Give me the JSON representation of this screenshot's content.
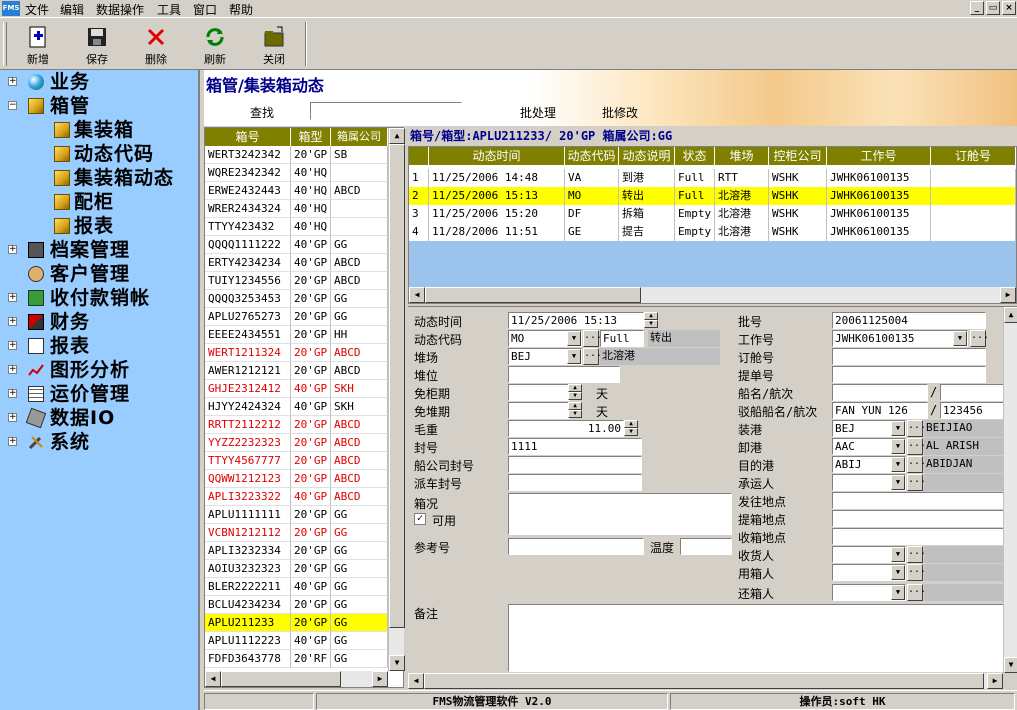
{
  "app": {
    "logo": "FMS"
  },
  "menu": [
    "文件",
    "编辑",
    "数据操作",
    "工具",
    "窗口",
    "帮助"
  ],
  "window_buttons": [
    "_",
    "▭",
    "×"
  ],
  "toolbar": {
    "new_label": "新增",
    "save_label": "保存",
    "delete_label": "删除",
    "refresh_label": "刷新",
    "close_label": "关闭"
  },
  "tree": [
    {
      "label": "业务",
      "icon": "globe-icon",
      "expanded": false
    },
    {
      "label": "箱管",
      "icon": "cube-icon",
      "expanded": true
    },
    {
      "label": "集装箱",
      "icon": "cube-icon",
      "child": true
    },
    {
      "label": "动态代码",
      "icon": "cube-icon",
      "child": true
    },
    {
      "label": "集装箱动态",
      "icon": "cube-icon",
      "child": true
    },
    {
      "label": "配柜",
      "icon": "cube-icon",
      "child": true
    },
    {
      "label": "报表",
      "icon": "cube-icon",
      "child": true
    },
    {
      "label": "档案管理",
      "icon": "cabinet-icon",
      "expanded": false
    },
    {
      "label": "客户管理",
      "icon": "customers-icon",
      "expanded": false
    },
    {
      "label": "收付款销帐",
      "icon": "money-icon",
      "expanded": false
    },
    {
      "label": "财务",
      "icon": "book-icon",
      "expanded": false
    },
    {
      "label": "报表",
      "icon": "report-icon",
      "expanded": false
    },
    {
      "label": "图形分析",
      "icon": "chart-icon",
      "expanded": false
    },
    {
      "label": "运价管理",
      "icon": "ledger-icon",
      "expanded": false
    },
    {
      "label": "数据IO",
      "icon": "data-io-icon",
      "expanded": false
    },
    {
      "label": "系统",
      "icon": "tools-icon",
      "expanded": false
    }
  ],
  "header": {
    "title": "箱管/集装箱动态",
    "search_label": "查找",
    "search_value": "",
    "batch_process": "批处理",
    "batch_edit": "批修改"
  },
  "container_list": {
    "columns": [
      "箱号",
      "箱型",
      "箱属公司"
    ],
    "rows": [
      {
        "no": "WERT3242342",
        "type": "20'GP",
        "owner": "SB",
        "color": "black"
      },
      {
        "no": "WQRE2342342",
        "type": "40'HQ",
        "owner": "",
        "color": "black"
      },
      {
        "no": "ERWE2432443",
        "type": "40'HQ",
        "owner": "ABCD",
        "color": "black"
      },
      {
        "no": "WRER2434324",
        "type": "40'HQ",
        "owner": "",
        "color": "black"
      },
      {
        "no": "TTYY423432",
        "type": "40'HQ",
        "owner": "",
        "color": "black"
      },
      {
        "no": "QQQQ1111222",
        "type": "40'GP",
        "owner": "GG",
        "color": "black"
      },
      {
        "no": "ERTY4234234",
        "type": "40'GP",
        "owner": "ABCD",
        "color": "black"
      },
      {
        "no": "TUIY1234556",
        "type": "20'GP",
        "owner": "ABCD",
        "color": "black"
      },
      {
        "no": "QQQQ3253453",
        "type": "20'GP",
        "owner": "GG",
        "color": "black"
      },
      {
        "no": "APLU2765273",
        "type": "20'GP",
        "owner": "GG",
        "color": "black"
      },
      {
        "no": "EEEE2434551",
        "type": "20'GP",
        "owner": "HH",
        "color": "black"
      },
      {
        "no": "WERT1211324",
        "type": "20'GP",
        "owner": "ABCD",
        "color": "red"
      },
      {
        "no": "AWER1212121",
        "type": "20'GP",
        "owner": "ABCD",
        "color": "black"
      },
      {
        "no": "GHJE2312412",
        "type": "40'GP",
        "owner": "SKH",
        "color": "red"
      },
      {
        "no": "HJYY2424324",
        "type": "40'GP",
        "owner": "SKH",
        "color": "black"
      },
      {
        "no": "RRTT2112212",
        "type": "20'GP",
        "owner": "ABCD",
        "color": "red"
      },
      {
        "no": "YYZZ2232323",
        "type": "20'GP",
        "owner": "ABCD",
        "color": "red"
      },
      {
        "no": "TTYY4567777",
        "type": "20'GP",
        "owner": "ABCD",
        "color": "red"
      },
      {
        "no": "QQWW1212123",
        "type": "20'GP",
        "owner": "ABCD",
        "color": "red"
      },
      {
        "no": "APLI3223322",
        "type": "40'GP",
        "owner": "ABCD",
        "color": "red"
      },
      {
        "no": "APLU1111111",
        "type": "20'GP",
        "owner": "GG",
        "color": "black"
      },
      {
        "no": "VCBN1212112",
        "type": "20'GP",
        "owner": "GG",
        "color": "red"
      },
      {
        "no": "APLI3232334",
        "type": "20'GP",
        "owner": "GG",
        "color": "black"
      },
      {
        "no": "AOIU3232323",
        "type": "20'GP",
        "owner": "GG",
        "color": "black"
      },
      {
        "no": "BLER2222211",
        "type": "40'GP",
        "owner": "GG",
        "color": "black"
      },
      {
        "no": "BCLU4234234",
        "type": "20'GP",
        "owner": "GG",
        "color": "black"
      },
      {
        "no": "APLU211233",
        "type": "20'GP",
        "owner": "GG",
        "color": "black",
        "selected": true
      },
      {
        "no": "APLU1112223",
        "type": "40'GP",
        "owner": "GG",
        "color": "black"
      },
      {
        "no": "FDFD3643778",
        "type": "20'RF",
        "owner": "GG",
        "color": "black"
      }
    ]
  },
  "grid": {
    "info": "箱号/箱型:APLU211233/ 20'GP    箱属公司:GG",
    "columns": [
      "",
      "动态时间",
      "动态代码",
      "动态说明",
      "状态",
      "堆场",
      "控柜公司",
      "工作号",
      "订舱号"
    ],
    "rows": [
      {
        "idx": "1",
        "time": "11/25/2006 14:48",
        "code": "VA",
        "desc": "到港",
        "status": "Full",
        "yard": "RTT",
        "company": "WSHK",
        "job": "JWHK06100135",
        "booking": ""
      },
      {
        "idx": "2",
        "time": "11/25/2006 15:13",
        "code": "MO",
        "desc": "转出",
        "status": "Full",
        "yard": "北溶港",
        "company": "WSHK",
        "job": "JWHK06100135",
        "booking": "",
        "selected": true
      },
      {
        "idx": "3",
        "time": "11/25/2006 15:20",
        "code": "DF",
        "desc": "拆箱",
        "status": "Empty",
        "yard": "北溶港",
        "company": "WSHK",
        "job": "JWHK06100135",
        "booking": ""
      },
      {
        "idx": "4",
        "time": "11/28/2006 11:51",
        "code": "GE",
        "desc": "提吉",
        "status": "Empty",
        "yard": "北溶港",
        "company": "WSHK",
        "job": "JWHK06100135",
        "booking": ""
      }
    ]
  },
  "form": {
    "labels": {
      "dyn_time": "动态时间",
      "dyn_code": "动态代码",
      "yard": "堆场",
      "slot": "堆位",
      "free_cab": "免柜期",
      "free_stack": "免堆期",
      "gross": "毛重",
      "seal": "封号",
      "ship_seal": "船公司封号",
      "truck_seal": "派车封号",
      "box_status": "箱况",
      "usable": "可用",
      "ref": "参考号",
      "temp": "温度",
      "remark": "备注",
      "batch": "批号",
      "job": "工作号",
      "booking": "订舱号",
      "bl": "提单号",
      "vessel": "船名/航次",
      "feeder": "驳船船名/航次",
      "pol": "装港",
      "pod": "卸港",
      "dest": "目的港",
      "carrier": "承运人",
      "ship_place": "发往地点",
      "pickup": "提箱地点",
      "collect": "收箱地点",
      "consignee": "收货人",
      "user": "用箱人",
      "returner": "还箱人"
    },
    "values": {
      "dyn_time": "11/25/2006 15:13",
      "dyn_code": "MO",
      "full": "Full",
      "code_desc": "转出",
      "yard": "BEJ",
      "yard_desc": "北溶港",
      "day_unit": "天",
      "gross": "11.00",
      "seal": "1111",
      "batch": "20061125004",
      "job": "JWHK06100135",
      "feeder_name": "FAN YUN 126",
      "feeder_voy": "123456",
      "pol": "BEJ",
      "pol_desc": "BEIJIAO",
      "pod": "AAC",
      "pod_desc": "AL ARISH",
      "dest": "ABIJ",
      "dest_desc": "ABIDJAN",
      "slash": "/"
    }
  },
  "status": {
    "software": "FMS物流管理软件 V2.0",
    "operator": "操作员:soft HK"
  },
  "colors": {
    "tree_bg": "#99ccff",
    "header_bg": "#808000",
    "selected_row": "#ffff00",
    "red_text": "#e00000",
    "title": "#00008b"
  }
}
